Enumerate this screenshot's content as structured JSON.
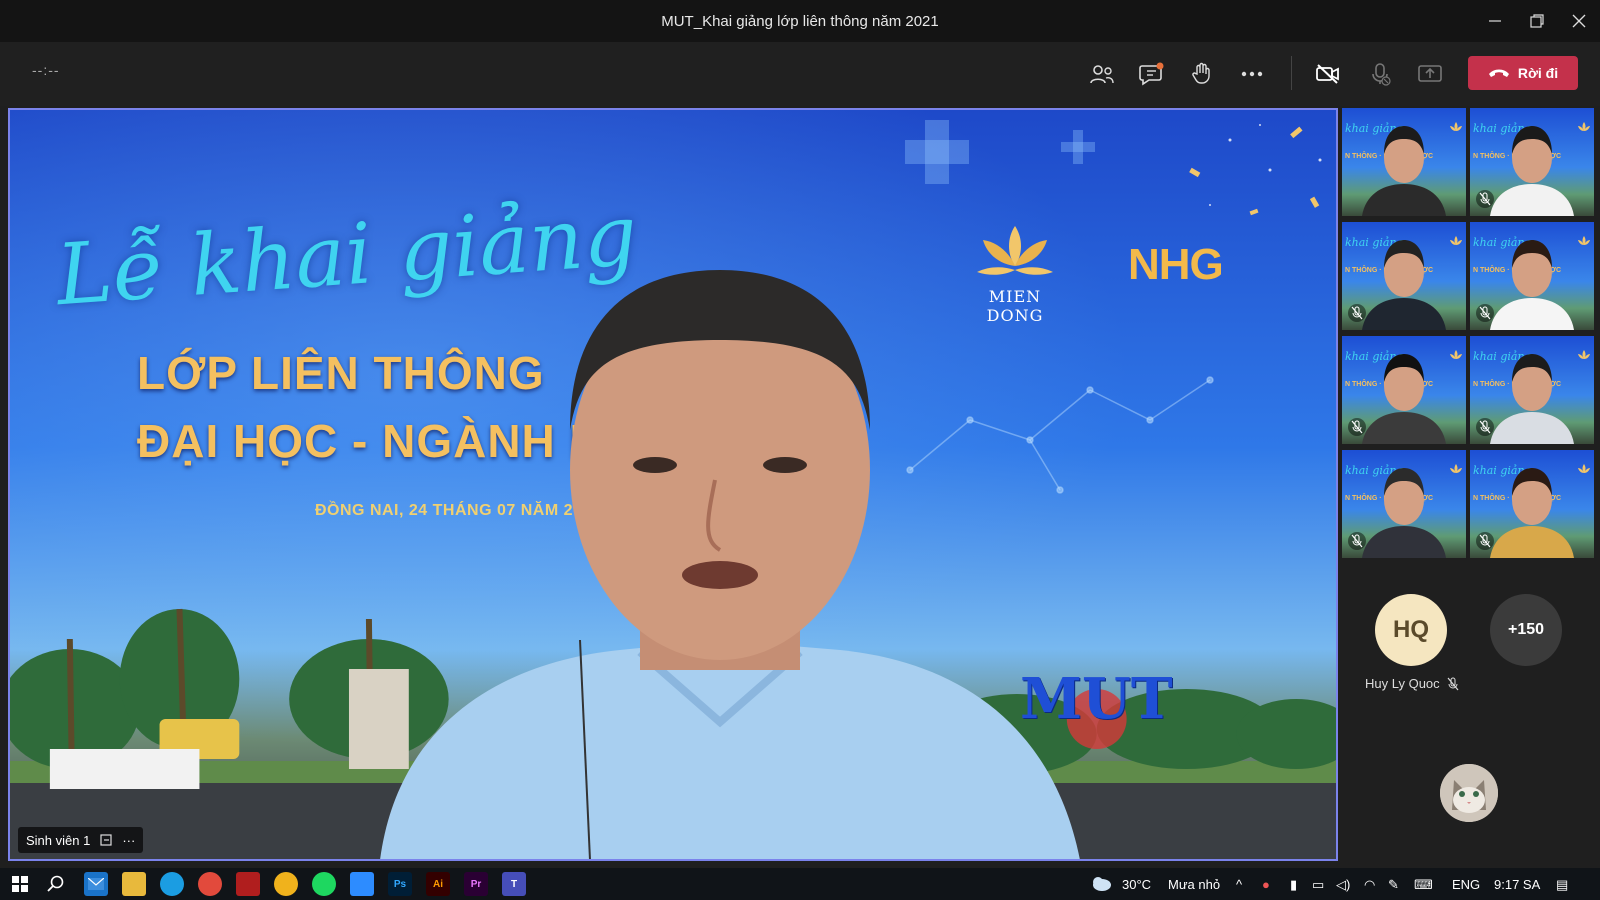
{
  "window": {
    "title": "MUT_Khai giảng lớp liên thông năm 2021",
    "minimize_icon": "minimize-icon",
    "restore_icon": "restore-icon",
    "close_icon": "close-icon"
  },
  "toolbar": {
    "timer": "--:--",
    "buttons": [
      "participants-icon",
      "chat-icon",
      "raise-hand-icon",
      "more-options-icon",
      "camera-off-icon",
      "mic-off-icon",
      "share-screen-icon"
    ],
    "leave_label": "Rời đi",
    "leave_color": "#c4314b"
  },
  "stage": {
    "speaker_name": "Sinh viên 1",
    "slide": {
      "script_title": "Lễ khai giảng",
      "line1": "LỚP LIÊN THÔNG",
      "line2": "ĐẠI HỌC - NGÀNH DƯỢC",
      "date": "ĐỒNG NAI, 24 THÁNG 07 NĂM 2021",
      "logo_left": "MIEN DONG",
      "logo_right": "NHG",
      "sign": "MUT"
    },
    "accent_border": "#7b83eb"
  },
  "participants": {
    "tile_slide_title": "khai giảng",
    "tile_slide_sub": "N THÔNG · NGÀNH DƯỢC",
    "hq_initials": "HQ",
    "hq_name": "Huy Ly Quoc",
    "more_count": "+150"
  },
  "taskbar": {
    "weather_temp": "30°C",
    "weather_desc": "Mưa nhỏ",
    "language": "ENG",
    "time": "9:17 SA",
    "app_ps": "Ps",
    "app_ai": "Ai",
    "app_pr": "Pr"
  }
}
